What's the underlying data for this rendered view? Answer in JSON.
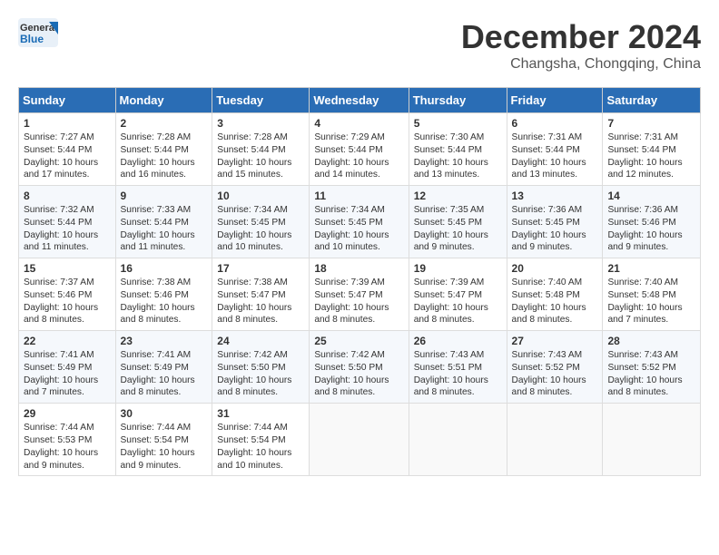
{
  "header": {
    "logo_general": "General",
    "logo_blue": "Blue",
    "month": "December 2024",
    "location": "Changsha, Chongqing, China"
  },
  "weekdays": [
    "Sunday",
    "Monday",
    "Tuesday",
    "Wednesday",
    "Thursday",
    "Friday",
    "Saturday"
  ],
  "weeks": [
    [
      {
        "day": "1",
        "info": "Sunrise: 7:27 AM\nSunset: 5:44 PM\nDaylight: 10 hours\nand 17 minutes."
      },
      {
        "day": "2",
        "info": "Sunrise: 7:28 AM\nSunset: 5:44 PM\nDaylight: 10 hours\nand 16 minutes."
      },
      {
        "day": "3",
        "info": "Sunrise: 7:28 AM\nSunset: 5:44 PM\nDaylight: 10 hours\nand 15 minutes."
      },
      {
        "day": "4",
        "info": "Sunrise: 7:29 AM\nSunset: 5:44 PM\nDaylight: 10 hours\nand 14 minutes."
      },
      {
        "day": "5",
        "info": "Sunrise: 7:30 AM\nSunset: 5:44 PM\nDaylight: 10 hours\nand 13 minutes."
      },
      {
        "day": "6",
        "info": "Sunrise: 7:31 AM\nSunset: 5:44 PM\nDaylight: 10 hours\nand 13 minutes."
      },
      {
        "day": "7",
        "info": "Sunrise: 7:31 AM\nSunset: 5:44 PM\nDaylight: 10 hours\nand 12 minutes."
      }
    ],
    [
      {
        "day": "8",
        "info": "Sunrise: 7:32 AM\nSunset: 5:44 PM\nDaylight: 10 hours\nand 11 minutes."
      },
      {
        "day": "9",
        "info": "Sunrise: 7:33 AM\nSunset: 5:44 PM\nDaylight: 10 hours\nand 11 minutes."
      },
      {
        "day": "10",
        "info": "Sunrise: 7:34 AM\nSunset: 5:45 PM\nDaylight: 10 hours\nand 10 minutes."
      },
      {
        "day": "11",
        "info": "Sunrise: 7:34 AM\nSunset: 5:45 PM\nDaylight: 10 hours\nand 10 minutes."
      },
      {
        "day": "12",
        "info": "Sunrise: 7:35 AM\nSunset: 5:45 PM\nDaylight: 10 hours\nand 9 minutes."
      },
      {
        "day": "13",
        "info": "Sunrise: 7:36 AM\nSunset: 5:45 PM\nDaylight: 10 hours\nand 9 minutes."
      },
      {
        "day": "14",
        "info": "Sunrise: 7:36 AM\nSunset: 5:46 PM\nDaylight: 10 hours\nand 9 minutes."
      }
    ],
    [
      {
        "day": "15",
        "info": "Sunrise: 7:37 AM\nSunset: 5:46 PM\nDaylight: 10 hours\nand 8 minutes."
      },
      {
        "day": "16",
        "info": "Sunrise: 7:38 AM\nSunset: 5:46 PM\nDaylight: 10 hours\nand 8 minutes."
      },
      {
        "day": "17",
        "info": "Sunrise: 7:38 AM\nSunset: 5:47 PM\nDaylight: 10 hours\nand 8 minutes."
      },
      {
        "day": "18",
        "info": "Sunrise: 7:39 AM\nSunset: 5:47 PM\nDaylight: 10 hours\nand 8 minutes."
      },
      {
        "day": "19",
        "info": "Sunrise: 7:39 AM\nSunset: 5:47 PM\nDaylight: 10 hours\nand 8 minutes."
      },
      {
        "day": "20",
        "info": "Sunrise: 7:40 AM\nSunset: 5:48 PM\nDaylight: 10 hours\nand 8 minutes."
      },
      {
        "day": "21",
        "info": "Sunrise: 7:40 AM\nSunset: 5:48 PM\nDaylight: 10 hours\nand 7 minutes."
      }
    ],
    [
      {
        "day": "22",
        "info": "Sunrise: 7:41 AM\nSunset: 5:49 PM\nDaylight: 10 hours\nand 7 minutes."
      },
      {
        "day": "23",
        "info": "Sunrise: 7:41 AM\nSunset: 5:49 PM\nDaylight: 10 hours\nand 8 minutes."
      },
      {
        "day": "24",
        "info": "Sunrise: 7:42 AM\nSunset: 5:50 PM\nDaylight: 10 hours\nand 8 minutes."
      },
      {
        "day": "25",
        "info": "Sunrise: 7:42 AM\nSunset: 5:50 PM\nDaylight: 10 hours\nand 8 minutes."
      },
      {
        "day": "26",
        "info": "Sunrise: 7:43 AM\nSunset: 5:51 PM\nDaylight: 10 hours\nand 8 minutes."
      },
      {
        "day": "27",
        "info": "Sunrise: 7:43 AM\nSunset: 5:52 PM\nDaylight: 10 hours\nand 8 minutes."
      },
      {
        "day": "28",
        "info": "Sunrise: 7:43 AM\nSunset: 5:52 PM\nDaylight: 10 hours\nand 8 minutes."
      }
    ],
    [
      {
        "day": "29",
        "info": "Sunrise: 7:44 AM\nSunset: 5:53 PM\nDaylight: 10 hours\nand 9 minutes."
      },
      {
        "day": "30",
        "info": "Sunrise: 7:44 AM\nSunset: 5:54 PM\nDaylight: 10 hours\nand 9 minutes."
      },
      {
        "day": "31",
        "info": "Sunrise: 7:44 AM\nSunset: 5:54 PM\nDaylight: 10 hours\nand 10 minutes."
      },
      null,
      null,
      null,
      null
    ]
  ]
}
